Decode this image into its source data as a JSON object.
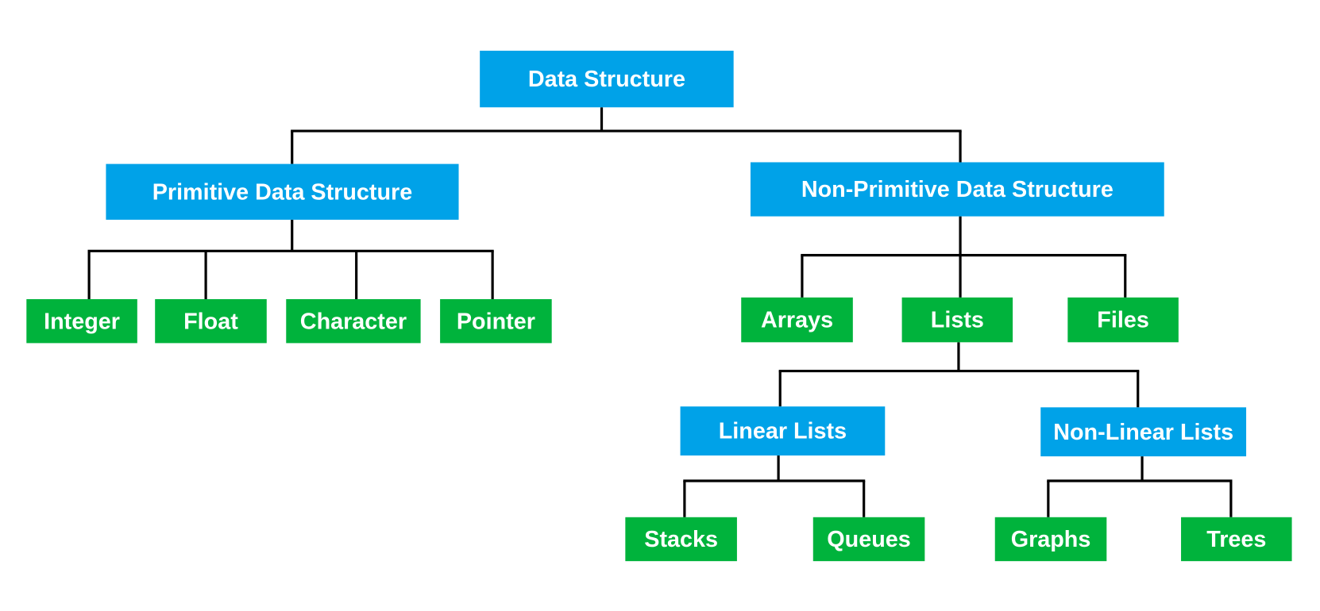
{
  "colors": {
    "category": "#00A2E8",
    "leaf": "#00B33C",
    "connector": "#000000",
    "text": "#ffffff"
  },
  "nodes": [
    {
      "id": "root",
      "label": "Data Structure",
      "kind": "category",
      "parent": null
    },
    {
      "id": "primitive",
      "label": "Primitive Data Structure",
      "kind": "category",
      "parent": "root"
    },
    {
      "id": "nonprimitive",
      "label": "Non-Primitive Data Structure",
      "kind": "category",
      "parent": "root"
    },
    {
      "id": "integer",
      "label": "Integer",
      "kind": "leaf",
      "parent": "primitive"
    },
    {
      "id": "float",
      "label": "Float",
      "kind": "leaf",
      "parent": "primitive"
    },
    {
      "id": "character",
      "label": "Character",
      "kind": "leaf",
      "parent": "primitive"
    },
    {
      "id": "pointer",
      "label": "Pointer",
      "kind": "leaf",
      "parent": "primitive"
    },
    {
      "id": "arrays",
      "label": "Arrays",
      "kind": "leaf",
      "parent": "nonprimitive"
    },
    {
      "id": "lists",
      "label": "Lists",
      "kind": "leaf",
      "parent": "nonprimitive"
    },
    {
      "id": "files",
      "label": "Files",
      "kind": "leaf",
      "parent": "nonprimitive"
    },
    {
      "id": "linear",
      "label": "Linear Lists",
      "kind": "category",
      "parent": "lists"
    },
    {
      "id": "nonlinear",
      "label": "Non-Linear Lists",
      "kind": "category",
      "parent": "lists"
    },
    {
      "id": "stacks",
      "label": "Stacks",
      "kind": "leaf",
      "parent": "linear"
    },
    {
      "id": "queues",
      "label": "Queues",
      "kind": "leaf",
      "parent": "linear"
    },
    {
      "id": "graphs",
      "label": "Graphs",
      "kind": "leaf",
      "parent": "nonlinear"
    },
    {
      "id": "trees",
      "label": "Trees",
      "kind": "leaf",
      "parent": "nonlinear"
    }
  ]
}
